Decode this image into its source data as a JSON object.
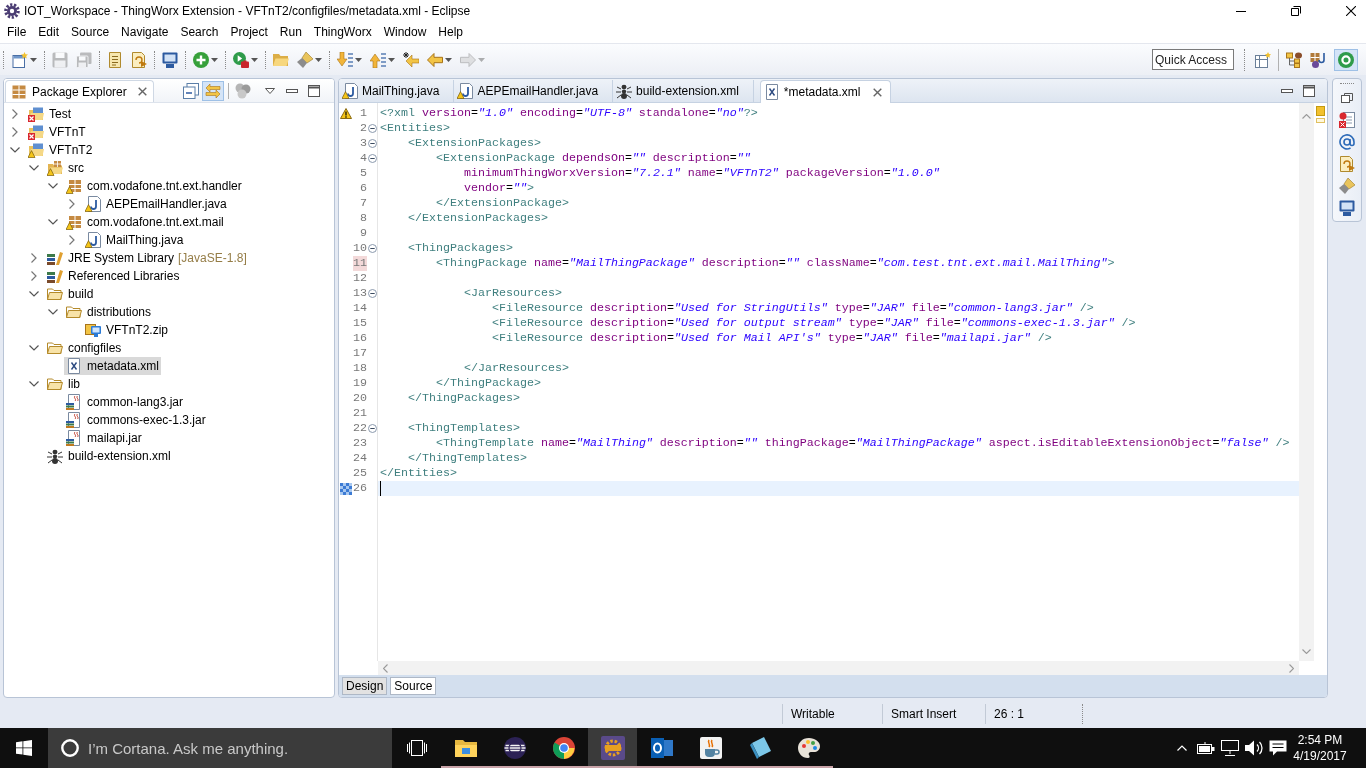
{
  "window": {
    "title": "IOT_Workspace - ThingWorx Extension - VFTnT2/configfiles/metadata.xml - Eclipse"
  },
  "menu": [
    "File",
    "Edit",
    "Source",
    "Navigate",
    "Search",
    "Project",
    "Run",
    "ThingWorx",
    "Window",
    "Help"
  ],
  "toolbar": [
    [
      {
        "dropdown": true,
        "disabled": false
      }
    ],
    [
      {
        "dropdown": false,
        "disabled": true
      },
      {
        "dropdown": false,
        "disabled": true
      }
    ],
    [
      {
        "dropdown": false,
        "disabled": false
      },
      {
        "dropdown": false,
        "disabled": false
      }
    ],
    [
      {
        "dropdown": false,
        "disabled": false
      }
    ],
    [
      {
        "dropdown": true,
        "disabled": false
      }
    ],
    [
      {
        "dropdown": true,
        "disabled": false
      }
    ],
    [
      {
        "dropdown": false,
        "disabled": false
      },
      {
        "dropdown": true,
        "disabled": false
      }
    ],
    [
      {
        "dropdown": true,
        "disabled": false
      },
      {
        "dropdown": true,
        "disabled": false
      },
      {
        "dropdown": false,
        "disabled": false
      },
      {
        "dropdown": true,
        "disabled": false
      },
      {
        "dropdown": true,
        "disabled": true
      }
    ]
  ],
  "quick_access": {
    "placeholder": "Quick Access"
  },
  "perspectives": [
    {
      "selected": false
    },
    {
      "selected": false
    },
    {
      "selected": true
    }
  ],
  "package_explorer": {
    "title": "Package Explorer",
    "link_with_editor": true,
    "tree": [
      {
        "label": "Test",
        "kind": "project",
        "error": true,
        "warning": false,
        "expanded": false,
        "selected": false
      },
      {
        "label": "VFTnT",
        "kind": "project",
        "error": true,
        "warning": false,
        "expanded": false,
        "selected": false
      },
      {
        "label": "VFTnT2",
        "kind": "project",
        "error": false,
        "warning": true,
        "expanded": true,
        "selected": false,
        "children": [
          {
            "label": "src",
            "kind": "source-folder",
            "error": false,
            "warning": true,
            "expanded": true,
            "selected": false,
            "children": [
              {
                "label": "com.vodafone.tnt.ext.handler",
                "kind": "package",
                "error": false,
                "warning": true,
                "expanded": true,
                "selected": false,
                "children": [
                  {
                    "label": "AEPEmailHandler.java",
                    "kind": "java-file",
                    "error": false,
                    "warning": true,
                    "expanded": false,
                    "selected": false
                  }
                ]
              },
              {
                "label": "com.vodafone.tnt.ext.mail",
                "kind": "package",
                "error": false,
                "warning": true,
                "expanded": true,
                "selected": false,
                "children": [
                  {
                    "label": "MailThing.java",
                    "kind": "java-file",
                    "error": false,
                    "warning": true,
                    "expanded": false,
                    "selected": false
                  }
                ]
              }
            ]
          },
          {
            "label": "JRE System Library",
            "decoration": "[JavaSE-1.8]",
            "kind": "library",
            "error": false,
            "warning": false,
            "expanded": false,
            "selected": false
          },
          {
            "label": "Referenced Libraries",
            "kind": "library",
            "error": false,
            "warning": false,
            "expanded": false,
            "selected": false
          },
          {
            "label": "build",
            "kind": "folder",
            "error": false,
            "warning": false,
            "expanded": true,
            "selected": false,
            "children": [
              {
                "label": "distributions",
                "kind": "folder",
                "error": false,
                "warning": false,
                "expanded": true,
                "selected": false,
                "children": [
                  {
                    "label": "VFTnT2.zip",
                    "kind": "archive",
                    "error": false,
                    "warning": false,
                    "selected": false
                  }
                ]
              }
            ]
          },
          {
            "label": "configfiles",
            "kind": "folder",
            "error": false,
            "warning": false,
            "expanded": true,
            "selected": false,
            "children": [
              {
                "label": "metadata.xml",
                "kind": "xml-file",
                "error": false,
                "warning": false,
                "selected": true
              }
            ]
          },
          {
            "label": "lib",
            "kind": "folder",
            "error": false,
            "warning": false,
            "expanded": true,
            "selected": false,
            "children": [
              {
                "label": "common-lang3.jar",
                "kind": "jar",
                "error": false,
                "warning": false,
                "selected": false
              },
              {
                "label": "commons-exec-1.3.jar",
                "kind": "jar",
                "error": false,
                "warning": false,
                "selected": false
              },
              {
                "label": "mailapi.jar",
                "kind": "jar",
                "error": false,
                "warning": false,
                "selected": false
              }
            ]
          },
          {
            "label": "build-extension.xml",
            "kind": "ant-file",
            "error": false,
            "warning": false,
            "selected": false
          }
        ]
      }
    ]
  },
  "editor": {
    "tabs": [
      {
        "label": "MailThing.java",
        "kind": "java-file",
        "warning": true,
        "selected": false
      },
      {
        "label": "AEPEmailHandler.java",
        "kind": "java-file",
        "warning": true,
        "selected": false
      },
      {
        "label": "build-extension.xml",
        "kind": "ant-file",
        "warning": false,
        "selected": false
      },
      {
        "label": "*metadata.xml",
        "kind": "xml-file",
        "warning": false,
        "selected": true
      }
    ],
    "lines": [
      {
        "number": "1",
        "warning": true,
        "marked": false,
        "foldable": false,
        "current": false,
        "number_highlighted": false,
        "code": [
          {
            "kind": "tag",
            "text": "<?xml"
          },
          {
            "kind": "attr",
            "text": " version"
          },
          {
            "kind": "eq",
            "text": "="
          },
          {
            "kind": "value",
            "text": "\"1.0\""
          },
          {
            "kind": "attr",
            "text": " encoding"
          },
          {
            "kind": "eq",
            "text": "="
          },
          {
            "kind": "value",
            "text": "\"UTF-8\""
          },
          {
            "kind": "attr",
            "text": " standalone"
          },
          {
            "kind": "eq",
            "text": "="
          },
          {
            "kind": "value",
            "text": "\"no\""
          },
          {
            "kind": "tag",
            "text": "?>"
          }
        ]
      },
      {
        "number": "2",
        "warning": false,
        "marked": false,
        "foldable": true,
        "current": false,
        "number_highlighted": false,
        "code": [
          {
            "kind": "tag",
            "text": "<Entities>"
          }
        ],
        "children": [
          {
            "number": "3",
            "warning": false,
            "marked": false,
            "foldable": true,
            "current": false,
            "number_highlighted": false,
            "code": [
              {
                "kind": "tag",
                "text": "<ExtensionPackages>"
              }
            ],
            "children": [
              {
                "number": "4",
                "warning": false,
                "marked": false,
                "foldable": true,
                "current": false,
                "number_highlighted": false,
                "code": [
                  {
                    "kind": "tag",
                    "text": "<ExtensionPackage"
                  },
                  {
                    "kind": "attr",
                    "text": " dependsOn"
                  },
                  {
                    "kind": "eq",
                    "text": "="
                  },
                  {
                    "kind": "value",
                    "text": "\"\""
                  },
                  {
                    "kind": "attr",
                    "text": " description"
                  },
                  {
                    "kind": "eq",
                    "text": "="
                  },
                  {
                    "kind": "value",
                    "text": "\"\""
                  }
                ],
                "children": [
                  {
                    "number": "5",
                    "warning": false,
                    "marked": false,
                    "foldable": false,
                    "current": false,
                    "number_highlighted": false,
                    "code": [
                      {
                        "kind": "attr",
                        "text": "minimumThingWorxVersion"
                      },
                      {
                        "kind": "eq",
                        "text": "="
                      },
                      {
                        "kind": "value",
                        "text": "\"7.2.1\""
                      },
                      {
                        "kind": "attr",
                        "text": " name"
                      },
                      {
                        "kind": "eq",
                        "text": "="
                      },
                      {
                        "kind": "value",
                        "text": "\"VFTnT2\""
                      },
                      {
                        "kind": "attr",
                        "text": " packageVersion"
                      },
                      {
                        "kind": "eq",
                        "text": "="
                      },
                      {
                        "kind": "value",
                        "text": "\"1.0.0\""
                      }
                    ]
                  },
                  {
                    "number": "6",
                    "warning": false,
                    "marked": false,
                    "foldable": false,
                    "current": false,
                    "number_highlighted": false,
                    "code": [
                      {
                        "kind": "attr",
                        "text": "vendor"
                      },
                      {
                        "kind": "eq",
                        "text": "="
                      },
                      {
                        "kind": "value",
                        "text": "\"\""
                      },
                      {
                        "kind": "tag",
                        "text": ">"
                      }
                    ]
                  }
                ]
              },
              {
                "number": "7",
                "warning": false,
                "marked": false,
                "foldable": false,
                "current": false,
                "number_highlighted": false,
                "code": [
                  {
                    "kind": "tag",
                    "text": "</ExtensionPackage>"
                  }
                ]
              }
            ]
          },
          {
            "number": "8",
            "warning": false,
            "marked": false,
            "foldable": false,
            "current": false,
            "number_highlighted": false,
            "code": [
              {
                "kind": "tag",
                "text": "</ExtensionPackages>"
              }
            ]
          },
          {
            "number": "9",
            "warning": false,
            "marked": false,
            "foldable": false,
            "current": false,
            "number_highlighted": false
          },
          {
            "number": "10",
            "warning": false,
            "marked": false,
            "foldable": true,
            "current": false,
            "number_highlighted": false,
            "code": [
              {
                "kind": "tag",
                "text": "<ThingPackages>"
              }
            ],
            "children": [
              {
                "number": "11",
                "warning": false,
                "marked": false,
                "foldable": false,
                "current": false,
                "number_highlighted": true,
                "code": [
                  {
                    "kind": "tag",
                    "text": "<ThingPackage"
                  },
                  {
                    "kind": "attr",
                    "text": " name"
                  },
                  {
                    "kind": "eq",
                    "text": "="
                  },
                  {
                    "kind": "value",
                    "text": "\"MailThingPackage\""
                  },
                  {
                    "kind": "attr",
                    "text": " description"
                  },
                  {
                    "kind": "eq",
                    "text": "="
                  },
                  {
                    "kind": "value",
                    "text": "\"\""
                  },
                  {
                    "kind": "attr",
                    "text": " className"
                  },
                  {
                    "kind": "eq",
                    "text": "="
                  },
                  {
                    "kind": "value",
                    "text": "\"com.test.tnt.ext.mail.MailThing\""
                  },
                  {
                    "kind": "tag",
                    "text": ">"
                  }
                ],
                "children": [
                  {
                    "number": "12",
                    "warning": false,
                    "marked": false,
                    "foldable": false,
                    "current": false,
                    "number_highlighted": false
                  },
                  {
                    "number": "13",
                    "warning": false,
                    "marked": false,
                    "foldable": true,
                    "current": false,
                    "number_highlighted": false,
                    "code": [
                      {
                        "kind": "tag",
                        "text": "<JarResources>"
                      }
                    ],
                    "children": [
                      {
                        "number": "14",
                        "warning": false,
                        "marked": false,
                        "foldable": false,
                        "current": false,
                        "number_highlighted": false,
                        "code": [
                          {
                            "kind": "tag",
                            "text": "<FileResource"
                          },
                          {
                            "kind": "attr",
                            "text": " description"
                          },
                          {
                            "kind": "eq",
                            "text": "="
                          },
                          {
                            "kind": "value",
                            "text": "\"Used for StringUtils\""
                          },
                          {
                            "kind": "attr",
                            "text": " type"
                          },
                          {
                            "kind": "eq",
                            "text": "="
                          },
                          {
                            "kind": "value",
                            "text": "\"JAR\""
                          },
                          {
                            "kind": "attr",
                            "text": " file"
                          },
                          {
                            "kind": "eq",
                            "text": "="
                          },
                          {
                            "kind": "value",
                            "text": "\"common-lang3.jar\""
                          },
                          {
                            "kind": "tag",
                            "text": " />"
                          }
                        ]
                      },
                      {
                        "number": "15",
                        "warning": false,
                        "marked": false,
                        "foldable": false,
                        "current": false,
                        "number_highlighted": false,
                        "code": [
                          {
                            "kind": "tag",
                            "text": "<FileResource"
                          },
                          {
                            "kind": "attr",
                            "text": " description"
                          },
                          {
                            "kind": "eq",
                            "text": "="
                          },
                          {
                            "kind": "value",
                            "text": "\"Used for output stream\""
                          },
                          {
                            "kind": "attr",
                            "text": " type"
                          },
                          {
                            "kind": "eq",
                            "text": "="
                          },
                          {
                            "kind": "value",
                            "text": "\"JAR\""
                          },
                          {
                            "kind": "attr",
                            "text": " file"
                          },
                          {
                            "kind": "eq",
                            "text": "="
                          },
                          {
                            "kind": "value",
                            "text": "\"commons-exec-1.3.jar\""
                          },
                          {
                            "kind": "tag",
                            "text": " />"
                          }
                        ]
                      },
                      {
                        "number": "16",
                        "warning": false,
                        "marked": false,
                        "foldable": false,
                        "current": false,
                        "number_highlighted": false,
                        "code": [
                          {
                            "kind": "tag",
                            "text": "<FileResource"
                          },
                          {
                            "kind": "attr",
                            "text": " description"
                          },
                          {
                            "kind": "eq",
                            "text": "="
                          },
                          {
                            "kind": "value",
                            "text": "\"Used for Mail API's\""
                          },
                          {
                            "kind": "attr",
                            "text": " type"
                          },
                          {
                            "kind": "eq",
                            "text": "="
                          },
                          {
                            "kind": "value",
                            "text": "\"JAR\""
                          },
                          {
                            "kind": "attr",
                            "text": " file"
                          },
                          {
                            "kind": "eq",
                            "text": "="
                          },
                          {
                            "kind": "value",
                            "text": "\"mailapi.jar\""
                          },
                          {
                            "kind": "tag",
                            "text": " />"
                          }
                        ]
                      },
                      {
                        "number": "17",
                        "warning": false,
                        "marked": false,
                        "foldable": false,
                        "current": false,
                        "number_highlighted": false
                      }
                    ]
                  },
                  {
                    "number": "18",
                    "warning": false,
                    "marked": false,
                    "foldable": false,
                    "current": false,
                    "number_highlighted": false,
                    "code": [
                      {
                        "kind": "tag",
                        "text": "</JarResources>"
                      }
                    ]
                  }
                ]
              },
              {
                "number": "19",
                "warning": false,
                "marked": false,
                "foldable": false,
                "current": false,
                "number_highlighted": false,
                "code": [
                  {
                    "kind": "tag",
                    "text": "</ThingPackage>"
                  }
                ]
              }
            ]
          },
          {
            "number": "20",
            "warning": false,
            "marked": false,
            "foldable": false,
            "current": false,
            "number_highlighted": false,
            "code": [
              {
                "kind": "tag",
                "text": "</ThingPackages>"
              }
            ]
          },
          {
            "number": "21",
            "warning": false,
            "marked": false,
            "foldable": false,
            "current": false,
            "number_highlighted": false
          },
          {
            "number": "22",
            "warning": false,
            "marked": false,
            "foldable": true,
            "current": false,
            "number_highlighted": false,
            "code": [
              {
                "kind": "tag",
                "text": "<ThingTemplates>"
              }
            ],
            "children": [
              {
                "number": "23",
                "warning": false,
                "marked": false,
                "foldable": false,
                "current": false,
                "number_highlighted": false,
                "code": [
                  {
                    "kind": "tag",
                    "text": "<ThingTemplate"
                  },
                  {
                    "kind": "attr",
                    "text": " name"
                  },
                  {
                    "kind": "eq",
                    "text": "="
                  },
                  {
                    "kind": "value",
                    "text": "\"MailThing\""
                  },
                  {
                    "kind": "attr",
                    "text": " description"
                  },
                  {
                    "kind": "eq",
                    "text": "="
                  },
                  {
                    "kind": "value",
                    "text": "\"\""
                  },
                  {
                    "kind": "attr",
                    "text": " thingPackage"
                  },
                  {
                    "kind": "eq",
                    "text": "="
                  },
                  {
                    "kind": "value",
                    "text": "\"MailThingPackage\""
                  },
                  {
                    "kind": "attr",
                    "text": " aspect.isEditableExtensionObject"
                  },
                  {
                    "kind": "eq",
                    "text": "="
                  },
                  {
                    "kind": "value",
                    "text": "\"false\""
                  },
                  {
                    "kind": "tag",
                    "text": " />"
                  }
                ]
              }
            ]
          },
          {
            "number": "24",
            "warning": false,
            "marked": false,
            "foldable": false,
            "current": false,
            "number_highlighted": false,
            "code": [
              {
                "kind": "tag",
                "text": "</ThingTemplates>"
              }
            ]
          }
        ]
      },
      {
        "number": "25",
        "warning": false,
        "marked": false,
        "foldable": false,
        "current": false,
        "number_highlighted": false,
        "code": [
          {
            "kind": "tag",
            "text": "</Entities>"
          }
        ]
      },
      {
        "number": "26",
        "warning": false,
        "marked": true,
        "foldable": false,
        "current": true,
        "number_highlighted": false
      }
    ],
    "bottom_tabs": [
      {
        "label": "Design",
        "selected": false
      },
      {
        "label": "Source",
        "selected": true
      }
    ]
  },
  "status_bar": {
    "state": "Writable",
    "insert_mode": "Smart Insert",
    "cursor_position": "26 : 1"
  },
  "taskbar": {
    "search": {
      "placeholder": "I’m Cortana. Ask me anything."
    },
    "apps": [
      {
        "selected": false,
        "running": true
      },
      {
        "selected": false,
        "running": true
      },
      {
        "selected": false,
        "running": true
      },
      {
        "selected": true,
        "running": true
      },
      {
        "selected": false,
        "running": true
      },
      {
        "selected": false,
        "running": true
      },
      {
        "selected": false,
        "running": true
      },
      {
        "selected": false,
        "running": true
      }
    ],
    "time": "2:54 PM",
    "date": "4/19/2017"
  }
}
